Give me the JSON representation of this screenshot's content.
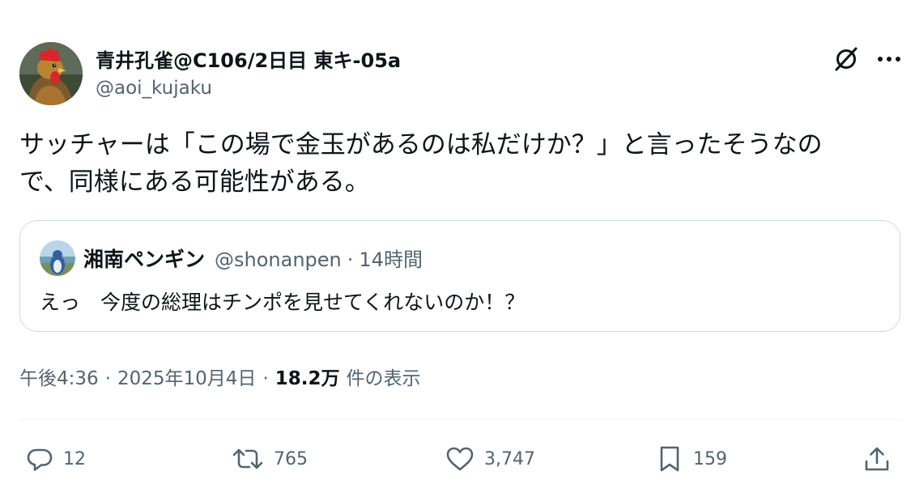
{
  "author": {
    "display_name": "青井孔雀@C106/2日目 東キ-05a",
    "handle": "@aoi_kujaku",
    "avatar_icon": "rooster-avatar"
  },
  "header_icons": {
    "grok": "grok-icon",
    "more": "more-icon"
  },
  "tweet": {
    "text_lines": [
      "サッチャーは「この場で金玉があるのは私だけか？」と言ったそうなの",
      "で、同様にある可能性がある。"
    ]
  },
  "quote": {
    "display_name": "湘南ペンギン",
    "handle": "@shonanpen",
    "dot": "·",
    "time": "14時間",
    "text": "えっ　今度の総理はチンポを見せてくれないのか！？"
  },
  "meta": {
    "time": "午後4:36",
    "sep1": "·",
    "date": "2025年10月4日",
    "sep2": "·",
    "views_count": "18.2万",
    "views_label": "件の表示"
  },
  "actions": {
    "reply_count": "12",
    "retweet_count": "765",
    "like_count": "3,747",
    "bookmark_count": "159"
  },
  "colors": {
    "text_primary": "#0f1419",
    "text_secondary": "#536471",
    "border": "#cfd9de",
    "divider": "#eff3f4"
  }
}
